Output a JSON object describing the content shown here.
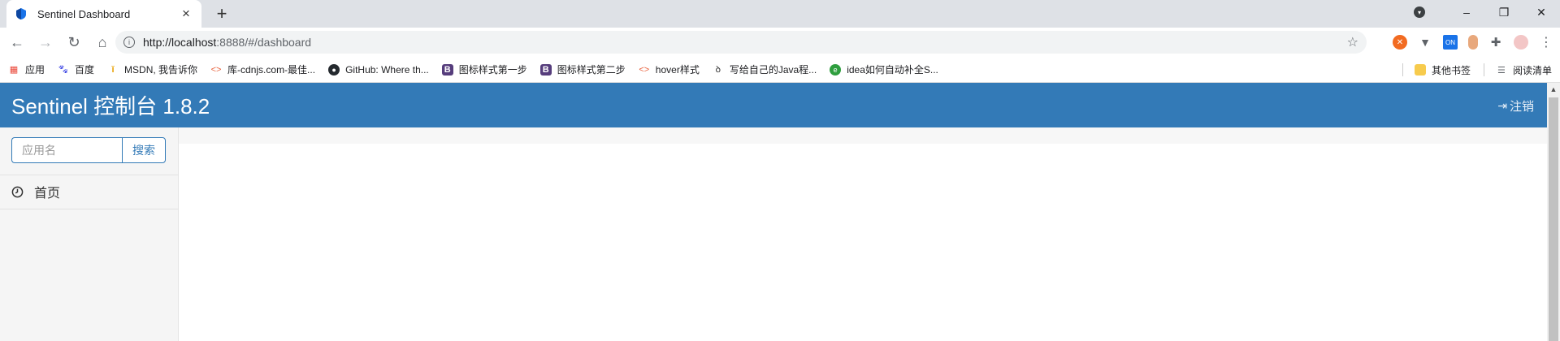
{
  "browser": {
    "tab": {
      "title": "Sentinel Dashboard",
      "favicon": "sentinel-shield-icon"
    },
    "new_tab_symbol": "+",
    "window_controls": {
      "minimize": "–",
      "restore": "❐",
      "close": "✕"
    },
    "address_bar": {
      "url_host": "http://localhost",
      "url_rest": ":8888/#/dashboard"
    },
    "bookmarks": [
      {
        "label": "应用",
        "icon": "apps-grid-icon",
        "color": "#ea4335"
      },
      {
        "label": "百度",
        "icon": "baidu-paw-icon",
        "color": "#2932e1"
      },
      {
        "label": "MSDN, 我告诉你",
        "icon": "msdn-icon",
        "color": "#e8a000"
      },
      {
        "label": "库-cdnjs.com-最佳...",
        "icon": "code-brackets-icon",
        "color": "#e8613c"
      },
      {
        "label": "GitHub: Where th...",
        "icon": "github-icon",
        "color": "#24292e"
      },
      {
        "label": "图标样式第一步",
        "icon": "bootstrap-icon",
        "color": "#563d7c"
      },
      {
        "label": "图标样式第二步",
        "icon": "bootstrap-icon",
        "color": "#563d7c"
      },
      {
        "label": "hover样式",
        "icon": "code-brackets-icon",
        "color": "#e8613c"
      },
      {
        "label": "写给自己的Java程...",
        "icon": "script-icon",
        "color": "#333333"
      },
      {
        "label": "idea如何自动补全S...",
        "icon": "e-circle-icon",
        "color": "#2e9e3e"
      }
    ],
    "bookmarks_right": [
      {
        "label": "其他书签",
        "icon": "folder-icon"
      },
      {
        "label": "阅读清单",
        "icon": "reading-list-icon"
      }
    ]
  },
  "app": {
    "brand": "Sentinel 控制台 1.8.2",
    "logout_label": "注销",
    "accent_color": "#337ab7",
    "sidebar": {
      "search_placeholder": "应用名",
      "search_button": "搜索",
      "nav_home": "首页"
    }
  }
}
